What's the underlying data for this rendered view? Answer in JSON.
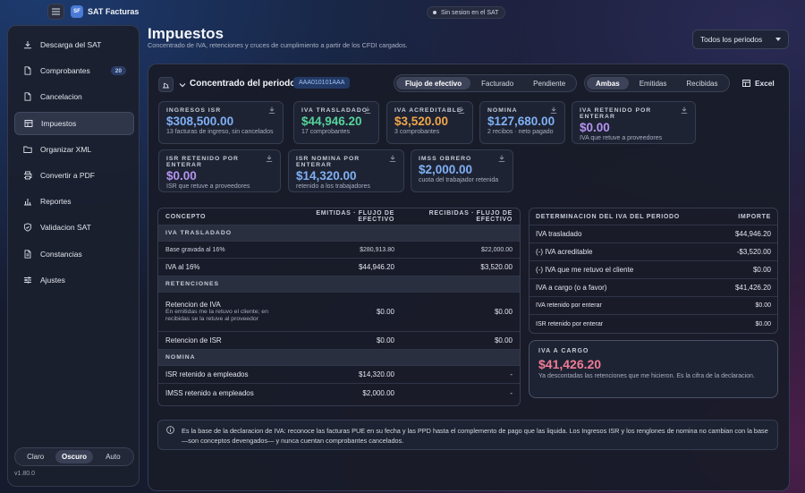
{
  "topbar": {
    "app_title": "SAT Facturas",
    "logo_text": "SF",
    "session_status": "Sin sesion en el SAT"
  },
  "sidebar": {
    "items": [
      {
        "label": "Descarga del SAT",
        "icon": "download-icon"
      },
      {
        "label": "Comprobantes",
        "icon": "document-icon",
        "badge": "20"
      },
      {
        "label": "Cancelacion",
        "icon": "document-icon"
      },
      {
        "label": "Impuestos",
        "icon": "table-icon",
        "active": true
      },
      {
        "label": "Organizar XML",
        "icon": "folder-icon"
      },
      {
        "label": "Convertir a PDF",
        "icon": "printer-icon"
      },
      {
        "label": "Reportes",
        "icon": "chart-icon"
      },
      {
        "label": "Validacion SAT",
        "icon": "shield-icon"
      },
      {
        "label": "Constancias",
        "icon": "document-icon"
      },
      {
        "label": "Ajustes",
        "icon": "sliders-icon"
      }
    ],
    "theme": {
      "light": "Claro",
      "dark": "Oscuro",
      "auto": "Auto",
      "selected": "Oscuro"
    },
    "version": "v1.80.0"
  },
  "page": {
    "title": "Impuestos",
    "subtitle": "Concentrado de IVA, retenciones y cruces de cumplimiento a partir de los CFDI cargados.",
    "period_select": "Todos los periodos"
  },
  "panel": {
    "title": "Concentrado del periodo",
    "rfc": "AAA010101AAA",
    "mode_tabs": [
      "Flujo de efectivo",
      "Facturado",
      "Pendiente"
    ],
    "mode_selected": "Flujo de efectivo",
    "direction_tabs": [
      "Ambas",
      "Emitidas",
      "Recibidas"
    ],
    "direction_selected": "Ambas",
    "excel_label": "Excel"
  },
  "cards": [
    {
      "label": "INGRESOS ISR",
      "value": "$308,500.00",
      "sub": "13 facturas de ingreso, sin cancelados",
      "color": "#7fb0f5"
    },
    {
      "label": "IVA TRASLADADO",
      "value": "$44,946.20",
      "sub": "17 comprobantes",
      "color": "#55d39a"
    },
    {
      "label": "IVA ACREDITABLE",
      "value": "$3,520.00",
      "sub": "3 comprobantes",
      "color": "#f0a64a"
    },
    {
      "label": "NOMINA",
      "value": "$127,680.00",
      "sub": "2 recibos · neto pagado",
      "color": "#7fb0f5"
    },
    {
      "label": "IVA RETENIDO POR ENTERAR",
      "value": "$0.00",
      "sub": "IVA que retuve a proveedores",
      "color": "#b493f0"
    },
    {
      "label": "ISR RETENIDO POR ENTERAR",
      "value": "$0.00",
      "sub": "ISR que retuve a proveedores",
      "color": "#b493f0"
    },
    {
      "label": "ISR NOMINA POR ENTERAR",
      "value": "$14,320.00",
      "sub": "retenido a los trabajadores",
      "color": "#7fb0f5"
    },
    {
      "label": "IMSS OBRERO",
      "value": "$2,000.00",
      "sub": "cuota del trabajador retenida",
      "color": "#7fb0f5"
    }
  ],
  "concept_table": {
    "headers": [
      "CONCEPTO",
      "EMITIDAS · FLUJO DE EFECTIVO",
      "RECIBIDAS · FLUJO DE EFECTIVO"
    ],
    "sections": [
      {
        "title": "IVA TRASLADADO",
        "rows": [
          {
            "concept": "Base gravada al 16%",
            "emitidas": "$280,913.80",
            "recibidas": "$22,000.00"
          },
          {
            "concept": "IVA al 16%",
            "emitidas": "$44,946.20",
            "recibidas": "$3,520.00"
          }
        ]
      },
      {
        "title": "RETENCIONES",
        "rows": [
          {
            "concept": "Retencion de IVA",
            "detail": "En emitidas me la retuvo el cliente; en recibidas se la retuve al proveedor",
            "emitidas": "$0.00",
            "recibidas": "$0.00"
          },
          {
            "concept": "Retencion de ISR",
            "emitidas": "$0.00",
            "recibidas": "$0.00"
          }
        ]
      },
      {
        "title": "NOMINA",
        "rows": [
          {
            "concept": "ISR retenido a empleados",
            "emitidas": "$14,320.00",
            "recibidas": "-"
          },
          {
            "concept": "IMSS retenido a empleados",
            "emitidas": "$2,000.00",
            "recibidas": "-"
          }
        ]
      }
    ]
  },
  "iva_table": {
    "headers": [
      "DETERMINACION DEL IVA DEL PERIODO",
      "IMPORTE"
    ],
    "rows": [
      {
        "label": "IVA trasladado",
        "value": "$44,946.20"
      },
      {
        "label": "(-) IVA acreditable",
        "value": "-$3,520.00"
      },
      {
        "label": "(-) IVA que me retuvo el cliente",
        "value": "$0.00"
      },
      {
        "label": "IVA a cargo (o a favor)",
        "value": "$41,426.20"
      },
      {
        "label": "IVA retenido por enterar",
        "value": "$0.00"
      },
      {
        "label": "ISR retenido por enterar",
        "value": "$0.00"
      }
    ]
  },
  "iva_card": {
    "label": "IVA A CARGO",
    "value": "$41,426.20",
    "sub": "Ya descontadas las retenciones que me hicieron. Es la cifra de la declaracion.",
    "color": "#f07b95"
  },
  "note": "Es la base de la declaracion de IVA: reconoce las facturas PUE en su fecha y las PPD hasta el complemento de pago que las liquida. Los Ingresos ISR y los renglones de nomina no cambian con la base —son conceptos devengados— y nunca cuentan comprobantes cancelados."
}
